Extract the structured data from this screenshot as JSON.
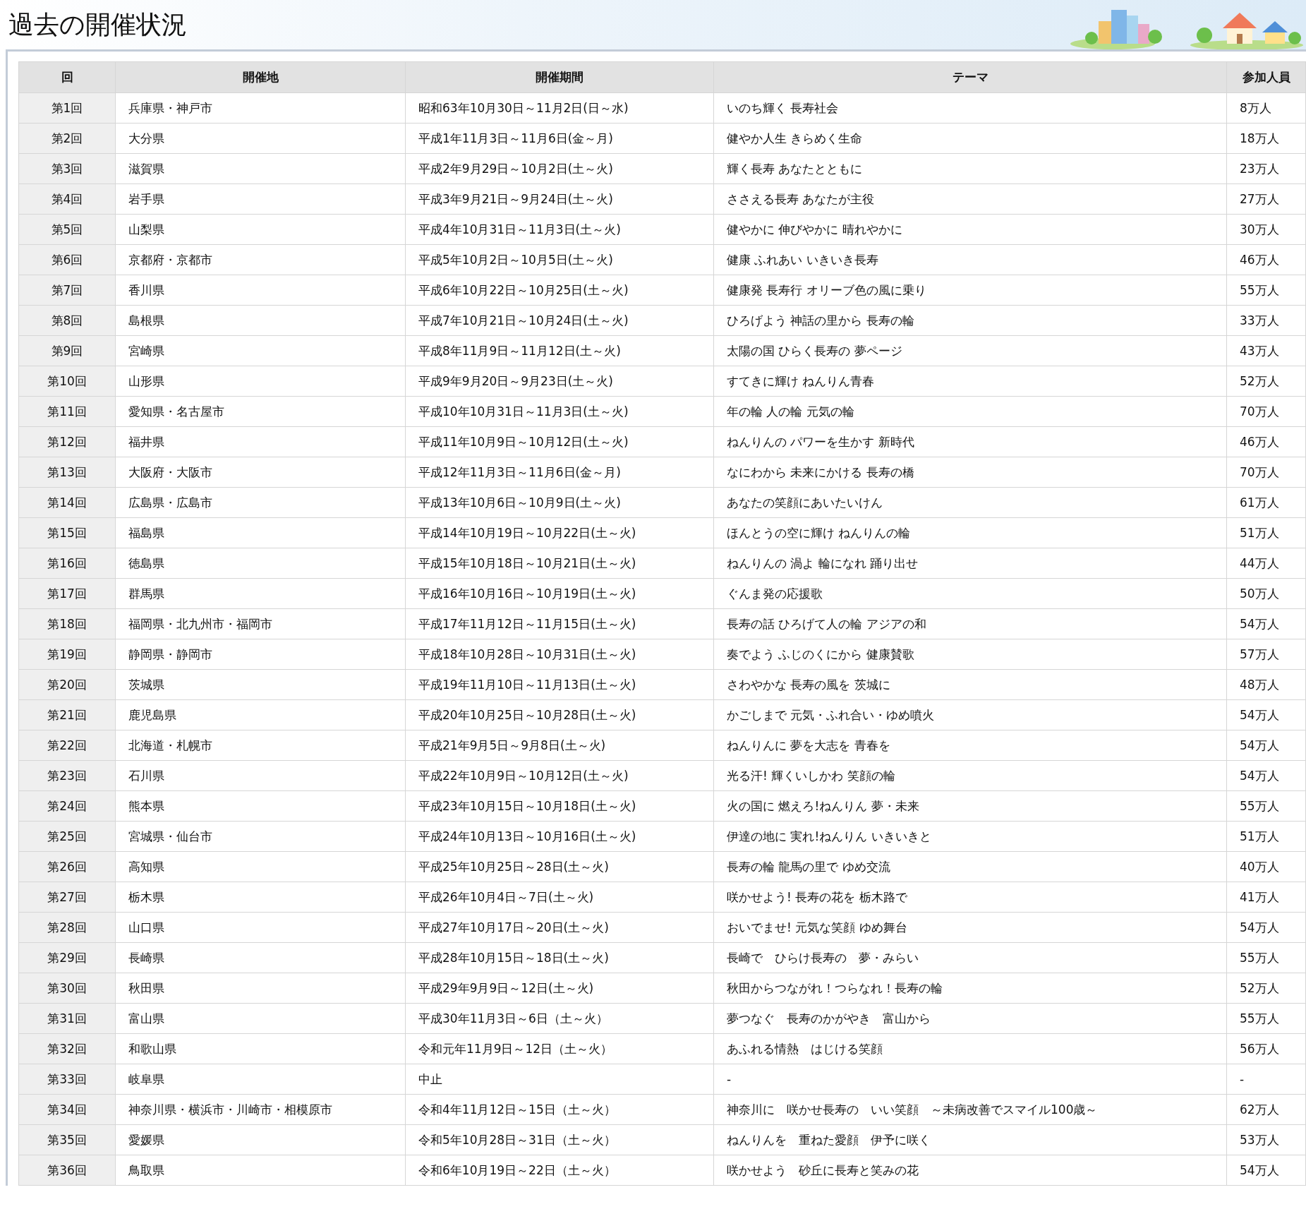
{
  "page_title": "過去の開催状況",
  "table": {
    "columns": [
      "回",
      "開催地",
      "開催期間",
      "テーマ",
      "参加人員"
    ],
    "rows": [
      {
        "round": "第1回",
        "venue": "兵庫県・神戸市",
        "period": "昭和63年10月30日～11月2日(日～水)",
        "theme": "いのち輝く 長寿社会",
        "attendance": "8万人"
      },
      {
        "round": "第2回",
        "venue": "大分県",
        "period": "平成1年11月3日～11月6日(金～月)",
        "theme": "健やか人生 きらめく生命",
        "attendance": "18万人"
      },
      {
        "round": "第3回",
        "venue": "滋賀県",
        "period": "平成2年9月29日～10月2日(土～火)",
        "theme": "輝く長寿 あなたとともに",
        "attendance": "23万人"
      },
      {
        "round": "第4回",
        "venue": "岩手県",
        "period": "平成3年9月21日～9月24日(土～火)",
        "theme": "ささえる長寿 あなたが主役",
        "attendance": "27万人"
      },
      {
        "round": "第5回",
        "venue": "山梨県",
        "period": "平成4年10月31日～11月3日(土～火)",
        "theme": "健やかに 伸びやかに 晴れやかに",
        "attendance": "30万人"
      },
      {
        "round": "第6回",
        "venue": "京都府・京都市",
        "period": "平成5年10月2日～10月5日(土～火)",
        "theme": "健康 ふれあい いきいき長寿",
        "attendance": "46万人"
      },
      {
        "round": "第7回",
        "venue": "香川県",
        "period": "平成6年10月22日～10月25日(土～火)",
        "theme": "健康発 長寿行 オリーブ色の風に乗り",
        "attendance": "55万人"
      },
      {
        "round": "第8回",
        "venue": "島根県",
        "period": "平成7年10月21日～10月24日(土～火)",
        "theme": "ひろげよう 神話の里から 長寿の輪",
        "attendance": "33万人"
      },
      {
        "round": "第9回",
        "venue": "宮崎県",
        "period": "平成8年11月9日～11月12日(土～火)",
        "theme": "太陽の国 ひらく長寿の 夢ページ",
        "attendance": "43万人"
      },
      {
        "round": "第10回",
        "venue": "山形県",
        "period": "平成9年9月20日～9月23日(土～火)",
        "theme": "すてきに輝け ねんりん青春",
        "attendance": "52万人"
      },
      {
        "round": "第11回",
        "venue": "愛知県・名古屋市",
        "period": "平成10年10月31日～11月3日(土～火)",
        "theme": "年の輪 人の輪 元気の輪",
        "attendance": "70万人"
      },
      {
        "round": "第12回",
        "venue": "福井県",
        "period": "平成11年10月9日～10月12日(土～火)",
        "theme": "ねんりんの パワーを生かす 新時代",
        "attendance": "46万人"
      },
      {
        "round": "第13回",
        "venue": "大阪府・大阪市",
        "period": "平成12年11月3日～11月6日(金～月)",
        "theme": "なにわから 未来にかける 長寿の橋",
        "attendance": "70万人"
      },
      {
        "round": "第14回",
        "venue": "広島県・広島市",
        "period": "平成13年10月6日～10月9日(土～火)",
        "theme": "あなたの笑顔にあいたいけん",
        "attendance": "61万人"
      },
      {
        "round": "第15回",
        "venue": "福島県",
        "period": "平成14年10月19日～10月22日(土～火)",
        "theme": "ほんとうの空に輝け ねんりんの輪",
        "attendance": "51万人"
      },
      {
        "round": "第16回",
        "venue": "徳島県",
        "period": "平成15年10月18日～10月21日(土～火)",
        "theme": "ねんりんの 渦よ 輪になれ 踊り出せ",
        "attendance": "44万人"
      },
      {
        "round": "第17回",
        "venue": "群馬県",
        "period": "平成16年10月16日～10月19日(土～火)",
        "theme": "ぐんま発の応援歌",
        "attendance": "50万人"
      },
      {
        "round": "第18回",
        "venue": "福岡県・北九州市・福岡市",
        "period": "平成17年11月12日～11月15日(土～火)",
        "theme": "長寿の話 ひろげて人の輪 アジアの和",
        "attendance": "54万人"
      },
      {
        "round": "第19回",
        "venue": "静岡県・静岡市",
        "period": "平成18年10月28日～10月31日(土～火)",
        "theme": "奏でよう ふじのくにから 健康賛歌",
        "attendance": "57万人"
      },
      {
        "round": "第20回",
        "venue": "茨城県",
        "period": "平成19年11月10日～11月13日(土～火)",
        "theme": "さわやかな 長寿の風を 茨城に",
        "attendance": "48万人"
      },
      {
        "round": "第21回",
        "venue": "鹿児島県",
        "period": "平成20年10月25日～10月28日(土～火)",
        "theme": "かごしまで 元気・ふれ合い・ゆめ噴火",
        "attendance": "54万人"
      },
      {
        "round": "第22回",
        "venue": "北海道・札幌市",
        "period": "平成21年9月5日～9月8日(土～火)",
        "theme": "ねんりんに 夢を大志を 青春を",
        "attendance": "54万人"
      },
      {
        "round": "第23回",
        "venue": "石川県",
        "period": "平成22年10月9日～10月12日(土～火)",
        "theme": "光る汗! 輝くいしかわ 笑顔の輪",
        "attendance": "54万人"
      },
      {
        "round": "第24回",
        "venue": "熊本県",
        "period": "平成23年10月15日～10月18日(土～火)",
        "theme": "火の国に 燃えろ!ねんりん 夢・未来",
        "attendance": "55万人"
      },
      {
        "round": "第25回",
        "venue": "宮城県・仙台市",
        "period": "平成24年10月13日～10月16日(土～火)",
        "theme": "伊達の地に 実れ!ねんりん いきいきと",
        "attendance": "51万人"
      },
      {
        "round": "第26回",
        "venue": "高知県",
        "period": "平成25年10月25日～28日(土～火)",
        "theme": "長寿の輪 龍馬の里で ゆめ交流",
        "attendance": "40万人"
      },
      {
        "round": "第27回",
        "venue": "栃木県",
        "period": "平成26年10月4日～7日(土～火)",
        "theme": "咲かせよう! 長寿の花を 栃木路で",
        "attendance": "41万人"
      },
      {
        "round": "第28回",
        "venue": "山口県",
        "period": "平成27年10月17日～20日(土～火)",
        "theme": "おいでませ! 元気な笑顔 ゆめ舞台",
        "attendance": "54万人"
      },
      {
        "round": "第29回",
        "venue": "長崎県",
        "period": "平成28年10月15日～18日(土～火)",
        "theme": "長崎で　ひらけ長寿の　夢・みらい",
        "attendance": "55万人"
      },
      {
        "round": "第30回",
        "venue": "秋田県",
        "period": "平成29年9月9日～12日(土～火)",
        "theme": "秋田からつながれ！つらなれ！長寿の輪",
        "attendance": "52万人"
      },
      {
        "round": "第31回",
        "venue": "富山県",
        "period": "平成30年11月3日～6日（土～火）",
        "theme": "夢つなぐ　長寿のかがやき　富山から",
        "attendance": "55万人"
      },
      {
        "round": "第32回",
        "venue": "和歌山県",
        "period": "令和元年11月9日～12日（土～火）",
        "theme": "あふれる情熱　はじける笑顔",
        "attendance": "56万人"
      },
      {
        "round": "第33回",
        "venue": "岐阜県",
        "period": "中止",
        "theme": "-",
        "attendance": "-"
      },
      {
        "round": "第34回",
        "venue": "神奈川県・横浜市・川崎市・相模原市",
        "period": "令和4年11月12日～15日（土～火）",
        "theme": "神奈川に　咲かせ長寿の　いい笑顔　～未病改善でスマイル100歳～",
        "attendance": "62万人"
      },
      {
        "round": "第35回",
        "venue": "愛媛県",
        "period": "令和5年10月28日～31日（土～火）",
        "theme": "ねんりんを　重ねた愛顔　伊予に咲く",
        "attendance": "53万人"
      },
      {
        "round": "第36回",
        "venue": "鳥取県",
        "period": "令和6年10月19日～22日（土～火）",
        "theme": "咲かせよう　砂丘に長寿と笑みの花",
        "attendance": "54万人"
      }
    ]
  }
}
